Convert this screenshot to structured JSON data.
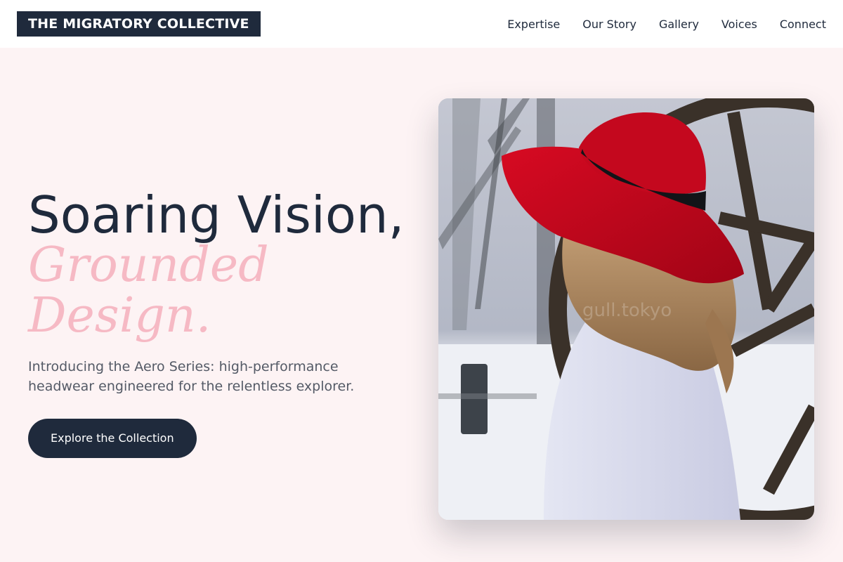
{
  "brand": {
    "name": "THE MIGRATORY COLLECTIVE"
  },
  "nav": {
    "items": [
      {
        "label": "Expertise"
      },
      {
        "label": "Our Story"
      },
      {
        "label": "Gallery"
      },
      {
        "label": "Voices"
      },
      {
        "label": "Connect"
      }
    ]
  },
  "hero": {
    "title_line1": "Soaring Vision,",
    "title_line2": "Grounded Design.",
    "intro": "Introducing the Aero Series: high-performance headwear engineered for the relentless explorer.",
    "cta_label": "Explore the Collection",
    "image_alt": "Woman in red wide-brim hat and white blouse beside a wooden wagon wheel in snow"
  },
  "colors": {
    "navy": "#1f2a3c",
    "pink_accent": "#f6b9c4",
    "background": "#fdf3f4",
    "hat_red": "#c0061b"
  }
}
